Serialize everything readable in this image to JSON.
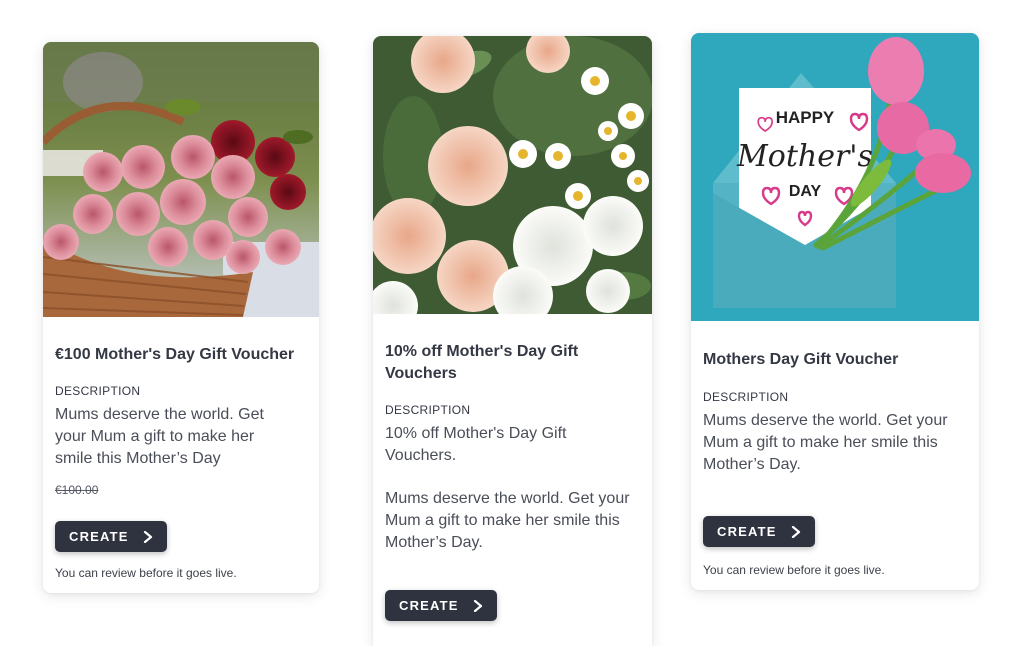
{
  "cards": [
    {
      "title": "€100 Mother's Day Gift Voucher",
      "description_label": "DESCRIPTION",
      "description": "Mums deserve the world. Get your Mum a gift to make her smile this Mother’s Day",
      "old_price": "€100.00",
      "button_label": "CREATE",
      "button_icon": "chevron-right-icon",
      "review_note": "You can review before it goes live.",
      "image": "basket of pink roses"
    },
    {
      "title": "10% off Mother's Day Gift Vouchers",
      "description_label": "DESCRIPTION",
      "description_line1": "10% off Mother's Day Gift Vouchers.",
      "description_line2": "Mums deserve the world. Get your Mum a gift to make her smile this Mother’s Day.",
      "button_label": "CREATE",
      "button_icon": "chevron-right-icon",
      "image": "bouquet of peach carnations and daisies"
    },
    {
      "title": "Mothers Day Gift Voucher",
      "description_label": "DESCRIPTION",
      "description": "Mums deserve the world. Get your Mum a gift to make her smile this Mother’s Day.",
      "button_label": "CREATE",
      "button_icon": "chevron-right-icon",
      "review_note": "You can review before it goes live.",
      "image": "happy mother's day card with tulips",
      "card_text": [
        "HAPPY",
        "Mother's",
        "DAY"
      ]
    }
  ],
  "colors": {
    "button_bg": "#2f333f",
    "button_text": "#ffffff",
    "title_text": "#343844",
    "card3_bg": "#2fa7bd"
  }
}
